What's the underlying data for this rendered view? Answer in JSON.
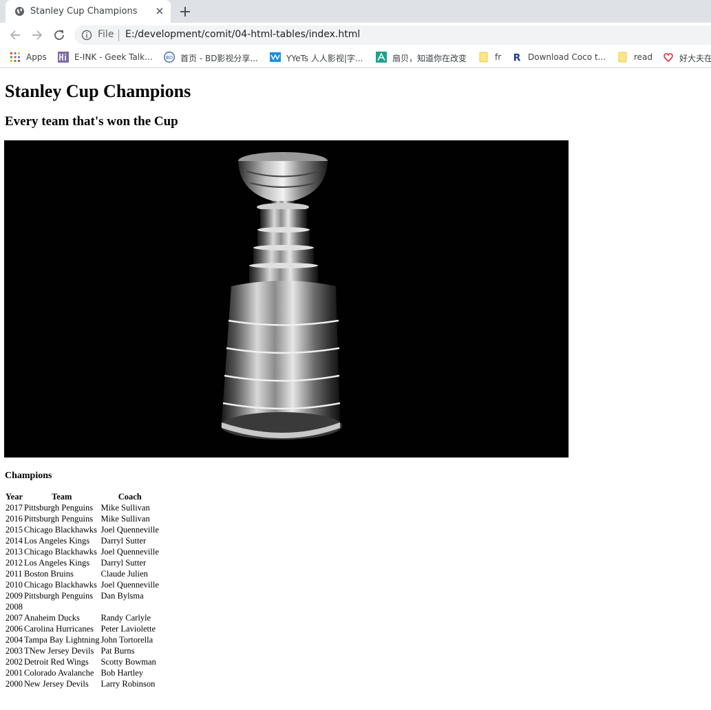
{
  "browser": {
    "tab": {
      "title": "Stanley Cup Champions"
    },
    "address": {
      "scheme_label": "File",
      "url": "E:/development/comit/04-html-tables/index.html"
    },
    "bookmarks": [
      {
        "label": "Apps",
        "icon": "apps-grid-icon"
      },
      {
        "label": "E-INK - Geek Talk...",
        "icon": "hi-icon"
      },
      {
        "label": "首页 - BD影视分享...",
        "icon": "bd-icon"
      },
      {
        "label": "YYeTs 人人影视|字...",
        "icon": "yyets-icon"
      },
      {
        "label": "扇贝，知道你在改变",
        "icon": "shanbay-icon"
      },
      {
        "label": "fr",
        "icon": "folder-icon"
      },
      {
        "label": "Download Coco t...",
        "icon": "r-icon"
      },
      {
        "label": "read",
        "icon": "folder-icon"
      },
      {
        "label": "好大夫在",
        "icon": "heart-icon"
      }
    ]
  },
  "page": {
    "title": "Stanley Cup Champions",
    "subtitle": "Every team that's won the Cup",
    "table": {
      "caption": "Champions",
      "headers": {
        "year": "Year",
        "team": "Team",
        "coach": "Coach"
      },
      "rows": [
        {
          "year": "2017",
          "team": "Pittsburgh Penguins",
          "coach": "Mike Sullivan"
        },
        {
          "year": "2016",
          "team": "Pittsburgh Penguins",
          "coach": "Mike Sullivan"
        },
        {
          "year": "2015",
          "team": "Chicago Blackhawks",
          "coach": "Joel Quenneville"
        },
        {
          "year": "2014",
          "team": "Los Angeles Kings",
          "coach": "Darryl Sutter"
        },
        {
          "year": "2013",
          "team": "Chicago Blackhawks",
          "coach": "Joel Quenneville"
        },
        {
          "year": "2012",
          "team": "Los Angeles Kings",
          "coach": "Darryl Sutter"
        },
        {
          "year": "2011",
          "team": "Boston Bruins",
          "coach": "Claude Julien"
        },
        {
          "year": "2010",
          "team": "Chicago Blackhawks",
          "coach": "Joel Quenneville"
        },
        {
          "year": "2009",
          "team": "Pittsburgh Penguins",
          "coach": "Dan Bylsma"
        },
        {
          "year": "2008",
          "team": "",
          "coach": ""
        },
        {
          "year": "2007",
          "team": "Anaheim Ducks",
          "coach": "Randy Carlyle"
        },
        {
          "year": "2006",
          "team": "Carolina Hurricanes",
          "coach": "Peter Laviolette"
        },
        {
          "year": "2004",
          "team": "Tampa Bay Lightning",
          "coach": "John Tortorella"
        },
        {
          "year": "2003",
          "team": "TNew Jersey Devils",
          "coach": "Pat Burns"
        },
        {
          "year": "2002",
          "team": "Detroit Red Wings",
          "coach": "Scotty Bowman"
        },
        {
          "year": "2001",
          "team": "Colorado Avalanche",
          "coach": "Bob Hartley"
        },
        {
          "year": "2000",
          "team": "New Jersey Devils",
          "coach": "Larry Robinson"
        }
      ]
    }
  },
  "colors": {
    "chrome_background": "#dee1e6",
    "omnibox_background": "#f1f3f4",
    "photo_background": "#010101"
  }
}
